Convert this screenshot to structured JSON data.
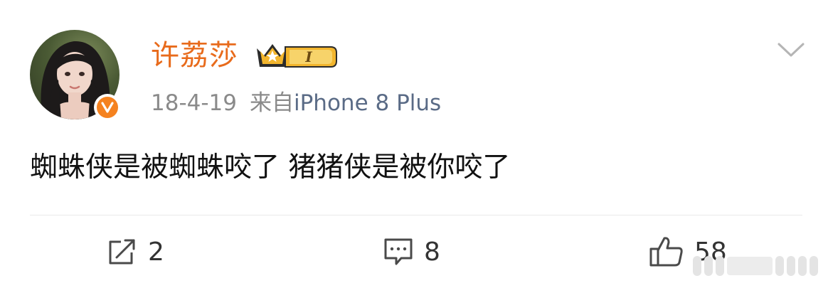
{
  "post": {
    "author": {
      "name": "许荔莎",
      "vip_level": "I",
      "verified": true
    },
    "date": "18-4-19",
    "source_prefix": "来自",
    "source_device": "iPhone 8 Plus",
    "text": "蜘蛛侠是被蜘蛛咬了 猪猪侠是被你咬了"
  },
  "actions": {
    "repost_count": "2",
    "comment_count": "8",
    "like_count": "58"
  },
  "colors": {
    "username": "#e86b1c",
    "meta": "#8a8a8a",
    "source": "#5a6b86",
    "verify_badge": "#f5821f",
    "vip_gold": "#f2b52d"
  },
  "icons": {
    "menu": "chevron-down-icon",
    "repost": "repost-icon",
    "comment": "comment-icon",
    "like": "thumbs-up-icon",
    "verified": "verified-v-icon",
    "vip": "crown-icon"
  }
}
